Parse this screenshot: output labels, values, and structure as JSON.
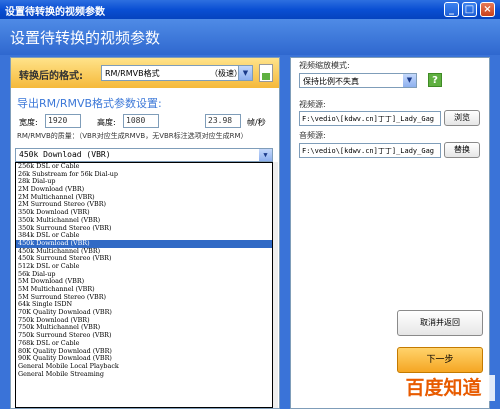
{
  "window": {
    "title": "设置待转换的视频参数",
    "minimize": "_",
    "maximize": "□",
    "close": "×"
  },
  "header": {
    "title": "设置待转换的视频参数"
  },
  "format": {
    "label": "转换后的格式:",
    "value": "RM/RMVB格式",
    "quality_tag": "（极速）"
  },
  "export": {
    "title": "导出RM/RMVB格式参数设置:",
    "width_label": "宽度:",
    "width_value": "1920",
    "height_label": "高度:",
    "height_value": "1080",
    "fps_value": "23.98",
    "fps_unit": "帧/秒",
    "quality_note": "RM/RMVB的质量：（VBR对应生成RMVB，无VBR标注选项对应生成RM）"
  },
  "quality_dropdown": {
    "selected": "450k Download (VBR)",
    "options": [
      "256k DSL or Cable",
      "26k Substream for 56k Dial-up",
      "28k Dial-up",
      "2M Download (VBR)",
      "2M Multichannel (VBR)",
      "2M Surround Stereo (VBR)",
      "350k Download (VBR)",
      "350k Multichannel (VBR)",
      "350k Surround Stereo (VBR)",
      "384k DSL or Cable",
      "450k Download (VBR)",
      "450k Multichannel (VBR)",
      "450k Surround Stereo (VBR)",
      "512k DSL or Cable",
      "56k Dial-up",
      "5M Download (VBR)",
      "5M Multichannel (VBR)",
      "5M Surround Stereo (VBR)",
      "64k Single ISDN",
      "70K Quality Download (VBR)",
      "750k Download (VBR)",
      "750k Multichannel (VBR)",
      "750k Surround Stereo (VBR)",
      "768k DSL or Cable",
      "80K Quality Download (VBR)",
      "90K Quality Download (VBR)",
      "General Mobile Local Playback",
      "General Mobile Streaming"
    ],
    "selected_index": 10
  },
  "right": {
    "zoom_label": "视频缩放模式:",
    "zoom_value": "保持比例不失真",
    "video_label": "视频源:",
    "video_path": "F:\\vedio\\[kdwv.cn]丁丁]_Lady_Gag",
    "browse_label": "浏览",
    "audio_label": "音频源:",
    "audio_path": "F:\\vedio\\[kdwv.cn]丁丁]_Lady_Gag",
    "replace_label": "替换",
    "cancel_label": "取消并返回",
    "next_label": "下一步"
  },
  "watermark": {
    "text": "百度知道"
  }
}
